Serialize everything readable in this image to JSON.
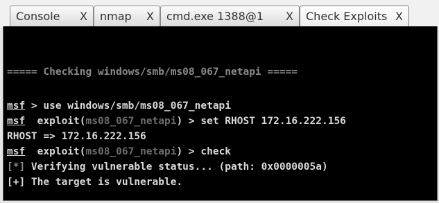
{
  "tabs": [
    {
      "label": "Console",
      "close": "X"
    },
    {
      "label": "nmap",
      "close": "X"
    },
    {
      "label": "cmd.exe 1388@1",
      "close": "X"
    },
    {
      "label": "Check Exploits",
      "close": "X"
    }
  ],
  "terminal": {
    "header": "===== Checking windows/smb/ms08_067_netapi =====",
    "prompt": "msf",
    "line1_rest": " > use windows/smb/ms08_067_netapi",
    "exploit_prefix": "  exploit(",
    "module": "ms08_067_netapi",
    "line2_rest": ") > set RHOST 172.16.222.156",
    "line3": "RHOST => 172.16.222.156",
    "line4_rest": ") > check",
    "status_info_tag": "[*]",
    "status_info": " Verifying vulnerable status... (path: 0x0000005a)",
    "status_ok_tag": "[+]",
    "status_ok": " The target is vulnerable."
  }
}
